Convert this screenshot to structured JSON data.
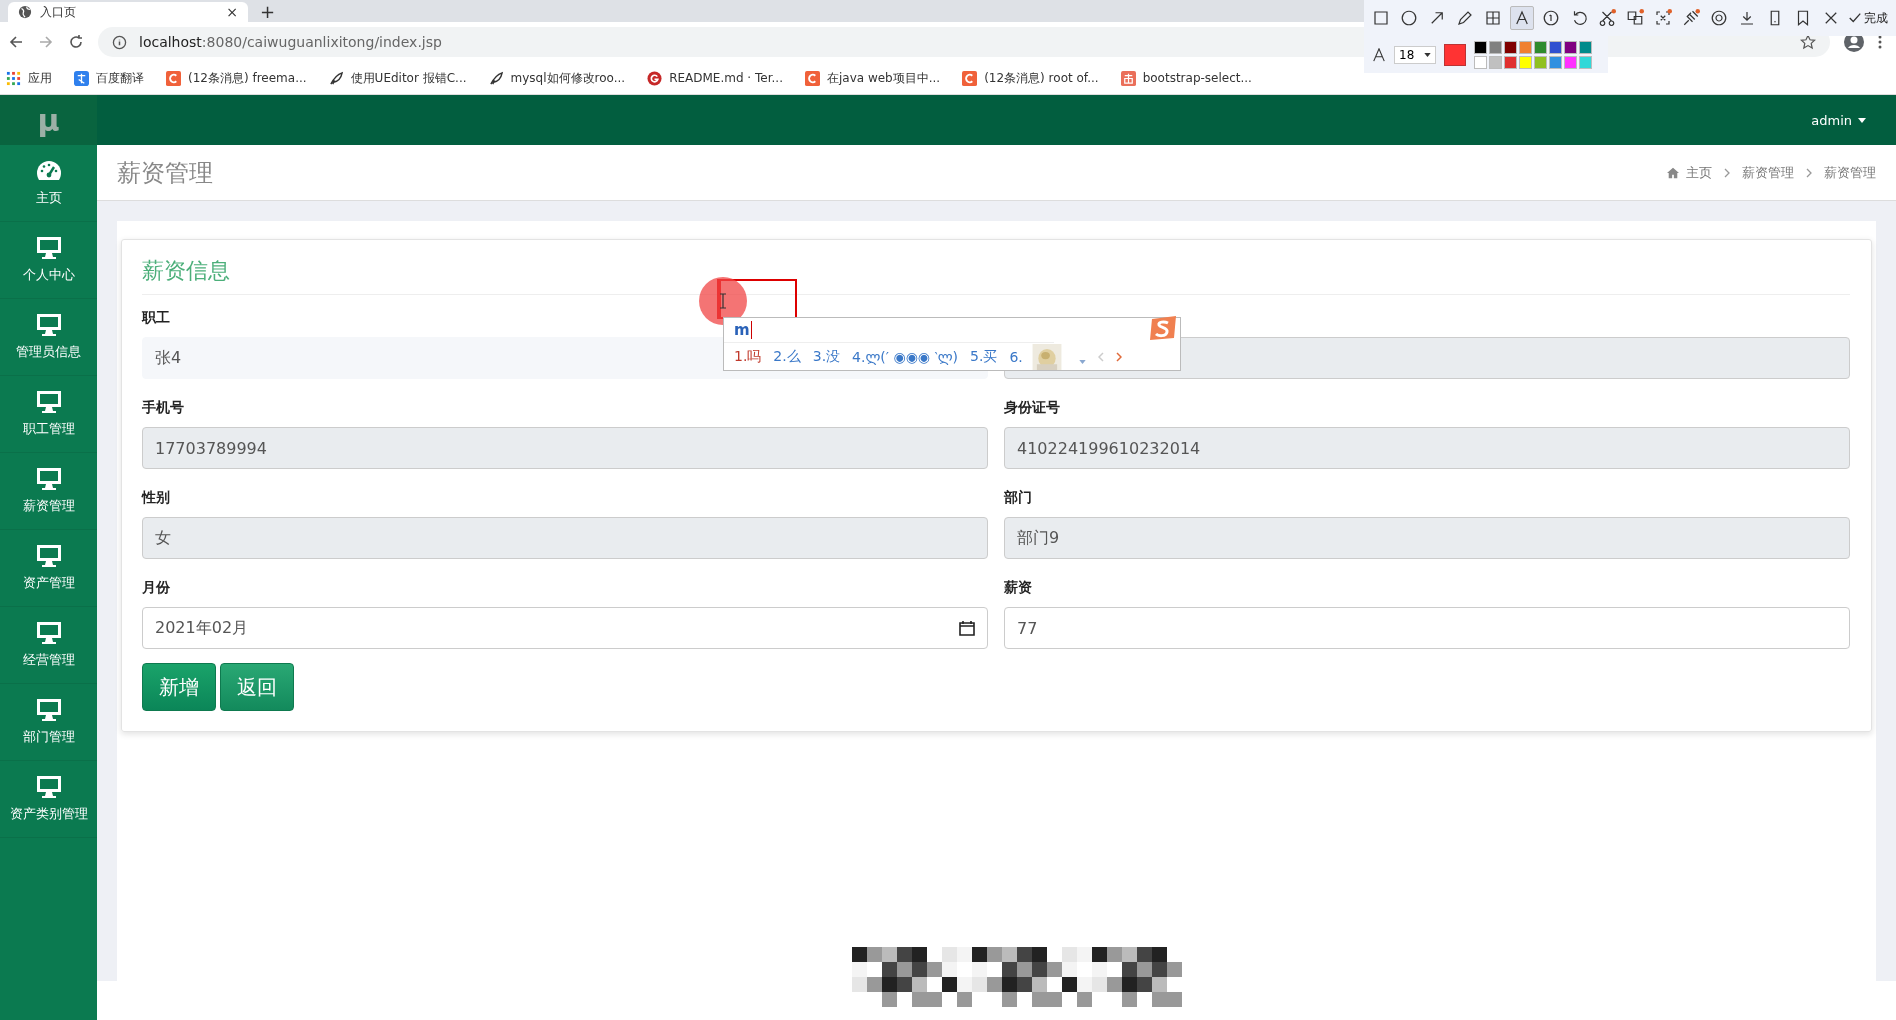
{
  "browser": {
    "tab": {
      "title": "入口页",
      "close": "×"
    },
    "new_tab": "+",
    "url": {
      "host": "localhost",
      "path": ":8080/caiwuguanlixitong/index.jsp"
    },
    "bookmarks": [
      {
        "kind": "apps",
        "label": "应用"
      },
      {
        "kind": "translate",
        "label": "百度翻译"
      },
      {
        "kind": "c",
        "label": "(12条消息) freema..."
      },
      {
        "kind": "feather",
        "label": "使用UEditor 报错C..."
      },
      {
        "kind": "feather",
        "label": "mysql如何修改roo..."
      },
      {
        "kind": "g",
        "label": "README.md · Ter..."
      },
      {
        "kind": "c",
        "label": "在java web项目中..."
      },
      {
        "kind": "c",
        "label": "(12条消息) root of..."
      },
      {
        "kind": "jian",
        "label": "bootstrap-select..."
      }
    ]
  },
  "screenshot_tool": {
    "tools": [
      {
        "kind": "rectangle",
        "selected": false,
        "badge": false
      },
      {
        "kind": "circle",
        "selected": false,
        "badge": false
      },
      {
        "kind": "arrow",
        "selected": false,
        "badge": false
      },
      {
        "kind": "pencil",
        "selected": false,
        "badge": false
      },
      {
        "kind": "mosaic",
        "selected": false,
        "badge": false
      },
      {
        "kind": "text",
        "selected": true,
        "badge": false
      },
      {
        "kind": "number",
        "selected": false,
        "badge": false
      },
      {
        "kind": "undo",
        "selected": false,
        "badge": false
      },
      {
        "kind": "scissors",
        "selected": false,
        "badge": true
      },
      {
        "kind": "translate",
        "selected": false,
        "badge": true
      },
      {
        "kind": "ocr",
        "selected": false,
        "badge": true
      },
      {
        "kind": "pin",
        "selected": false,
        "badge": true
      },
      {
        "kind": "record",
        "selected": false,
        "badge": false
      },
      {
        "kind": "download",
        "selected": false,
        "badge": false
      },
      {
        "kind": "phone",
        "selected": false,
        "badge": false
      },
      {
        "kind": "bookmark",
        "selected": false,
        "badge": false
      },
      {
        "kind": "close",
        "selected": false,
        "badge": false
      }
    ],
    "done": "完成",
    "font_size": "18",
    "palette": [
      {
        "color": "#000000"
      },
      {
        "color": "#808080"
      },
      {
        "color": "#800000"
      },
      {
        "color": "#f08030"
      },
      {
        "color": "#2e8b2e"
      },
      {
        "color": "#3050d0"
      },
      {
        "color": "#800080"
      },
      {
        "color": "#008b8b"
      },
      {
        "color": "#ffffff"
      },
      {
        "color": "#c0c0c0"
      },
      {
        "color": "#e03030"
      },
      {
        "color": "#ffff00"
      },
      {
        "color": "#90c020"
      },
      {
        "color": "#3090e0"
      },
      {
        "color": "#ff30ff"
      },
      {
        "color": "#30d8d8"
      }
    ]
  },
  "app": {
    "logo": "μ",
    "user": "admin",
    "sidebar": [
      {
        "kind": "dashboard",
        "label": "主页"
      },
      {
        "kind": "monitor",
        "label": "个人中心"
      },
      {
        "kind": "monitor",
        "label": "管理员信息"
      },
      {
        "kind": "monitor",
        "label": "职工管理"
      },
      {
        "kind": "monitor",
        "label": "薪资管理"
      },
      {
        "kind": "monitor",
        "label": "资产管理"
      },
      {
        "kind": "monitor",
        "label": "经营管理"
      },
      {
        "kind": "monitor",
        "label": "部门管理"
      },
      {
        "kind": "monitor",
        "label": "资产类别管理"
      }
    ],
    "page_title": "薪资管理",
    "breadcrumb": [
      "主页",
      "薪资管理",
      "薪资管理"
    ],
    "card_title": "薪资信息",
    "fields": [
      {
        "label": "职工",
        "value": "张4",
        "kind": "select",
        "disabled": true
      },
      {
        "kind": "text",
        "disabled": true
      },
      {
        "label": "手机号",
        "value": "17703789994",
        "kind": "text",
        "disabled": true
      },
      {
        "label": "身份证号",
        "value": "410224199610232014",
        "kind": "text",
        "disabled": true
      },
      {
        "label": "性别",
        "value": "女",
        "kind": "text",
        "disabled": true
      },
      {
        "label": "部门",
        "value": "部门9",
        "kind": "text",
        "disabled": true
      },
      {
        "label": "月份",
        "value": "2021年02月",
        "kind": "date",
        "disabled": false
      },
      {
        "label": "薪资",
        "value": "77",
        "kind": "text",
        "disabled": false
      }
    ],
    "buttons": [
      {
        "label": "新增",
        "kind": "primary"
      },
      {
        "label": "返回",
        "kind": "secondary"
      }
    ]
  },
  "ime": {
    "input": "m",
    "candidates": [
      {
        "text": "1.吗",
        "selected": true
      },
      {
        "text": "2.么",
        "selected": false
      },
      {
        "text": "3.没",
        "selected": false
      },
      {
        "text": "4.ლ(′ ◉◉◉ ‵ლ)",
        "selected": false
      },
      {
        "text": "5.买",
        "selected": false
      },
      {
        "text": "6.",
        "selected": false
      }
    ]
  }
}
